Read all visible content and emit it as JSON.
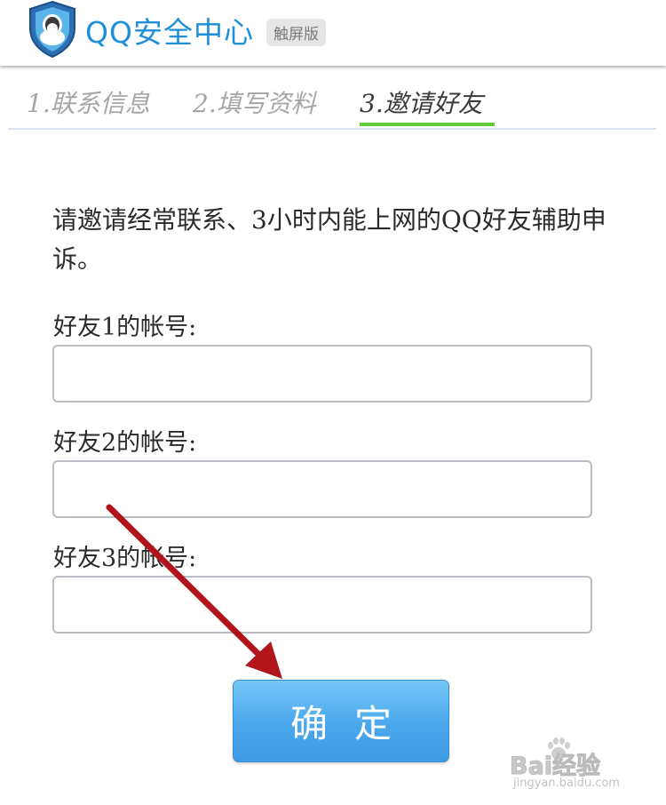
{
  "header": {
    "app_title": "QQ安全中心",
    "edition_badge": "触屏版",
    "brand_color": "#1f8fd8"
  },
  "steps": [
    {
      "label": "1.联系信息",
      "active": false
    },
    {
      "label": "2.填写资料",
      "active": false
    },
    {
      "label": "3.邀请好友",
      "active": true
    }
  ],
  "active_step_color": "#63cc3d",
  "instruction": "请邀请经常联系、3小时内能上网的QQ好友辅助申诉。",
  "fields": [
    {
      "label": "好友1的帐号:",
      "value": "",
      "placeholder": ""
    },
    {
      "label": "好友2的帐号:",
      "value": "",
      "placeholder": ""
    },
    {
      "label": "好友3的帐号:",
      "value": "",
      "placeholder": ""
    }
  ],
  "confirm_button": {
    "label": "确定",
    "color": "#4aa7ec"
  },
  "annotation": {
    "arrow_color": "#b0151c",
    "arrow_icon": "red-arrow-icon"
  },
  "watermark": {
    "logo_text": "Bai经验",
    "url": "jingyan.baidu.com"
  }
}
